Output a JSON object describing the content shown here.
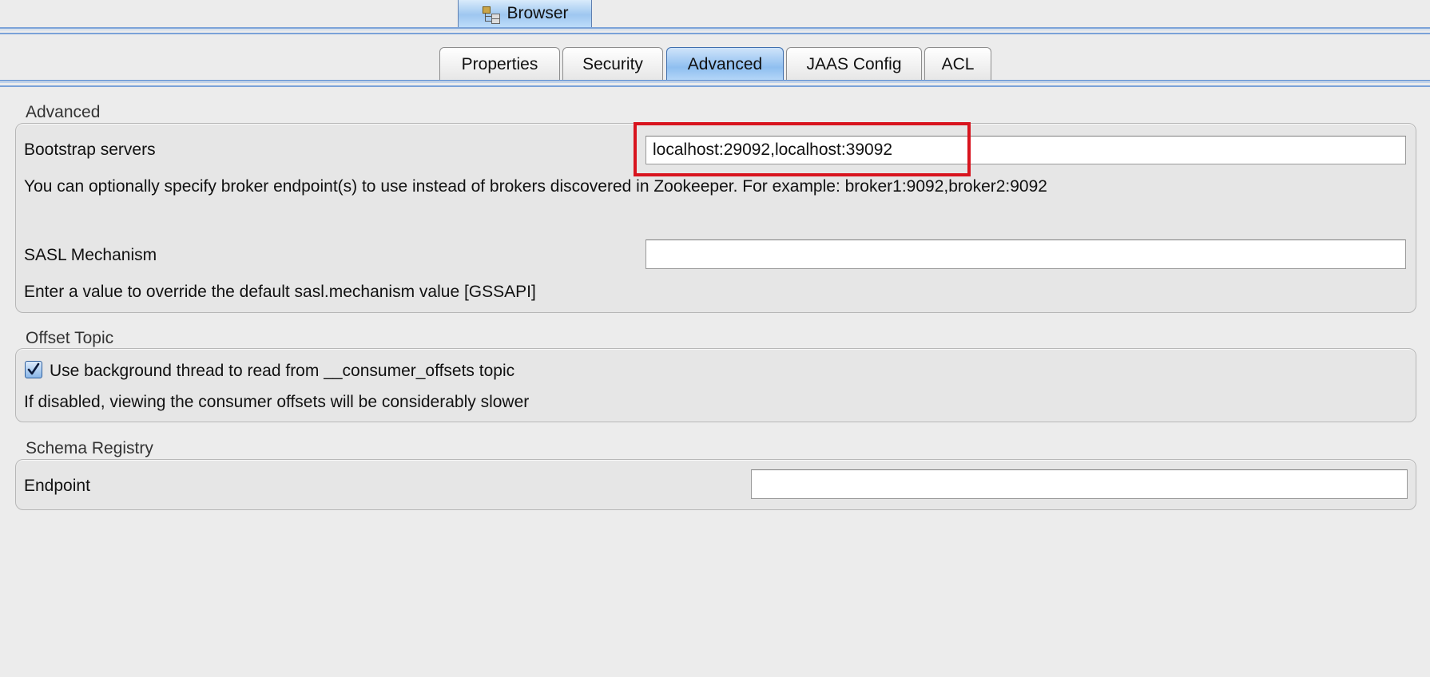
{
  "top_tab": {
    "label": "Browser",
    "icon": "tree-icon"
  },
  "tabs": [
    {
      "label": "Properties",
      "active": false
    },
    {
      "label": "Security",
      "active": false
    },
    {
      "label": "Advanced",
      "active": true
    },
    {
      "label": "JAAS Config",
      "active": false
    },
    {
      "label": "ACL",
      "active": false
    }
  ],
  "advanced": {
    "title": "Advanced",
    "bootstrap_label": "Bootstrap servers",
    "bootstrap_value": "localhost:29092,localhost:39092",
    "bootstrap_help": "You can optionally specify broker endpoint(s) to use instead of brokers discovered in Zookeeper. For example: broker1:9092,broker2:9092",
    "sasl_label": "SASL Mechanism",
    "sasl_value": "",
    "sasl_help": "Enter a value to override the default sasl.mechanism value [GSSAPI]"
  },
  "offset_topic": {
    "title": "Offset Topic",
    "checkbox_label": "Use background thread to read from __consumer_offsets topic",
    "checked": true,
    "help": "If disabled, viewing the consumer offsets will be considerably slower"
  },
  "schema_registry": {
    "title": "Schema Registry",
    "endpoint_label": "Endpoint",
    "endpoint_value": ""
  },
  "colors": {
    "highlight": "#d8141e",
    "active_tab": "#8fbff0",
    "accent_rule": "#7aa2d8"
  }
}
